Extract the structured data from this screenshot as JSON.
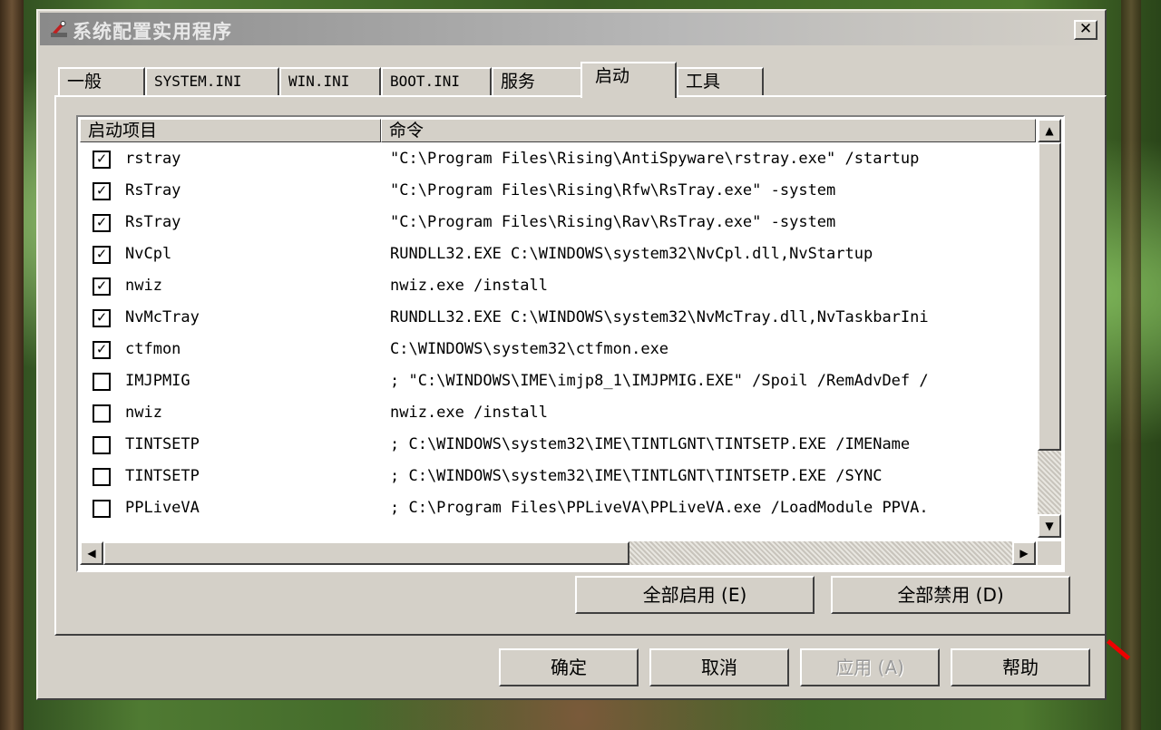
{
  "window": {
    "title": "系统配置实用程序",
    "close_glyph": "✕"
  },
  "tabs": [
    {
      "label": "一般"
    },
    {
      "label": "SYSTEM.INI"
    },
    {
      "label": "WIN.INI"
    },
    {
      "label": "BOOT.INI"
    },
    {
      "label": "服务"
    },
    {
      "label": "启动"
    },
    {
      "label": "工具"
    }
  ],
  "active_tab": "启动",
  "list": {
    "headers": {
      "item": "启动项目",
      "command": "命令"
    },
    "rows": [
      {
        "name": "rstray",
        "checked": true,
        "mark": "✓",
        "command": "\"C:\\Program Files\\Rising\\AntiSpyware\\rstray.exe\" /startup"
      },
      {
        "name": "RsTray",
        "checked": true,
        "mark": "✓",
        "command": "\"C:\\Program Files\\Rising\\Rfw\\RsTray.exe\" -system"
      },
      {
        "name": "RsTray",
        "checked": true,
        "mark": "✓",
        "command": "\"C:\\Program Files\\Rising\\Rav\\RsTray.exe\" -system"
      },
      {
        "name": "NvCpl",
        "checked": true,
        "mark": "✓",
        "command": "RUNDLL32.EXE C:\\WINDOWS\\system32\\NvCpl.dll,NvStartup"
      },
      {
        "name": "nwiz",
        "checked": true,
        "mark": "✓",
        "command": "nwiz.exe /install"
      },
      {
        "name": "NvMcTray",
        "checked": true,
        "mark": "✓",
        "command": "RUNDLL32.EXE C:\\WINDOWS\\system32\\NvMcTray.dll,NvTaskbarIni"
      },
      {
        "name": "ctfmon",
        "checked": true,
        "mark": "✓",
        "command": "C:\\WINDOWS\\system32\\ctfmon.exe"
      },
      {
        "name": "IMJPMIG",
        "checked": false,
        "mark": "",
        "command": "; \"C:\\WINDOWS\\IME\\imjp8_1\\IMJPMIG.EXE\" /Spoil /RemAdvDef /"
      },
      {
        "name": "nwiz",
        "checked": false,
        "mark": "",
        "command": "nwiz.exe /install"
      },
      {
        "name": "TINTSETP",
        "checked": false,
        "mark": "",
        "command": "; C:\\WINDOWS\\system32\\IME\\TINTLGNT\\TINTSETP.EXE /IMEName"
      },
      {
        "name": "TINTSETP",
        "checked": false,
        "mark": "",
        "command": "; C:\\WINDOWS\\system32\\IME\\TINTLGNT\\TINTSETP.EXE /SYNC"
      },
      {
        "name": "PPLiveVA",
        "checked": false,
        "mark": "",
        "command": "; C:\\Program Files\\PPLiveVA\\PPLiveVA.exe /LoadModule PPVA."
      }
    ]
  },
  "scroll": {
    "up": "▲",
    "down": "▼",
    "left": "◀",
    "right": "▶"
  },
  "buttons": {
    "enable_all": "全部启用 (E)",
    "disable_all": "全部禁用 (D)",
    "ok": "确定",
    "cancel": "取消",
    "apply": "应用 (A)",
    "help": "帮助"
  },
  "apply_enabled": false,
  "icons": {
    "title_icon": "msconfig-icon"
  }
}
